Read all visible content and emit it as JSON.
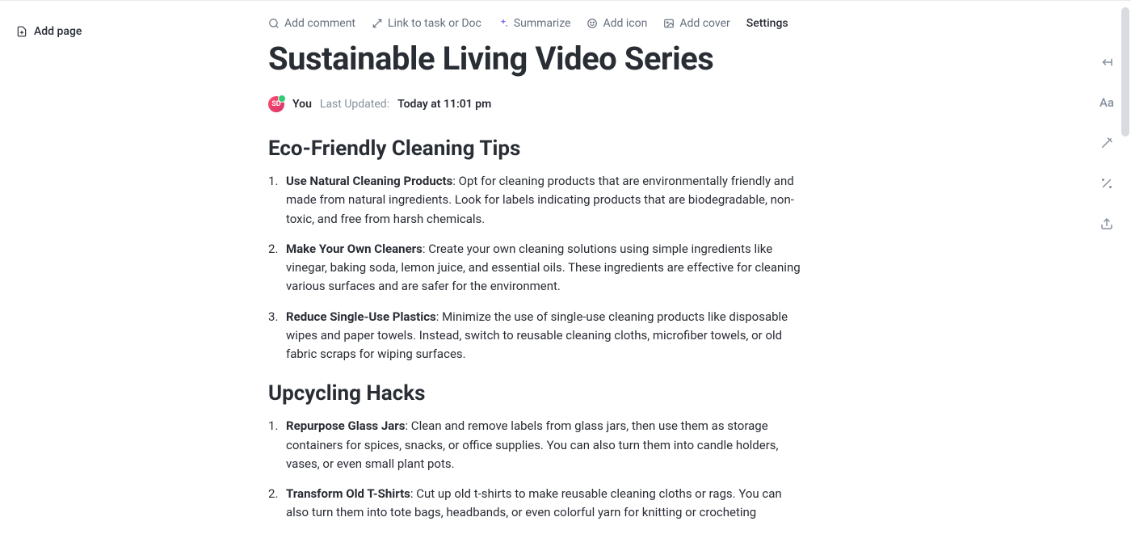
{
  "sidebar": {
    "add_page_label": "Add page"
  },
  "toolbar": {
    "add_comment": "Add comment",
    "link_task": "Link to task or Doc",
    "summarize": "Summarize",
    "add_icon": "Add icon",
    "add_cover": "Add cover",
    "settings": "Settings"
  },
  "page": {
    "title": "Sustainable Living Video Series"
  },
  "meta": {
    "avatar_initials": "SD",
    "you_label": "You",
    "last_updated_label": "Last Updated:",
    "last_updated_value": "Today at 11:01 pm"
  },
  "sections": [
    {
      "heading": "Eco-Friendly Cleaning Tips",
      "items": [
        {
          "title": "Use Natural Cleaning Products",
          "body": ": Opt for cleaning products that are environmentally friendly and made from natural ingredients. Look for labels indicating products that are biodegradable, non-toxic, and free from harsh chemicals."
        },
        {
          "title": "Make Your Own Cleaners",
          "body": ": Create your own cleaning solutions using simple ingredients like vinegar, baking soda, lemon juice, and essential oils. These ingredients are effective for cleaning various surfaces and are safer for the environment."
        },
        {
          "title": "Reduce Single-Use Plastics",
          "body": ": Minimize the use of single-use cleaning products like disposable wipes and paper towels. Instead, switch to reusable cleaning cloths, microfiber towels, or old fabric scraps for wiping surfaces."
        }
      ]
    },
    {
      "heading": "Upcycling Hacks",
      "items": [
        {
          "title": "Repurpose Glass Jars",
          "body": ": Clean and remove labels from glass jars, then use them as storage containers for spices, snacks, or office supplies. You can also turn them into candle holders, vases, or even small plant pots."
        },
        {
          "title": "Transform Old T-Shirts",
          "body": ": Cut up old t-shirts to make reusable cleaning cloths or rags. You can also turn them into tote bags, headbands, or even colorful yarn for knitting or crocheting"
        }
      ]
    }
  ],
  "right_rail": {
    "collapse": "collapse-arrow",
    "font": "Aa",
    "style": "style-wand",
    "ai": "ai-sparkle",
    "share": "share"
  }
}
